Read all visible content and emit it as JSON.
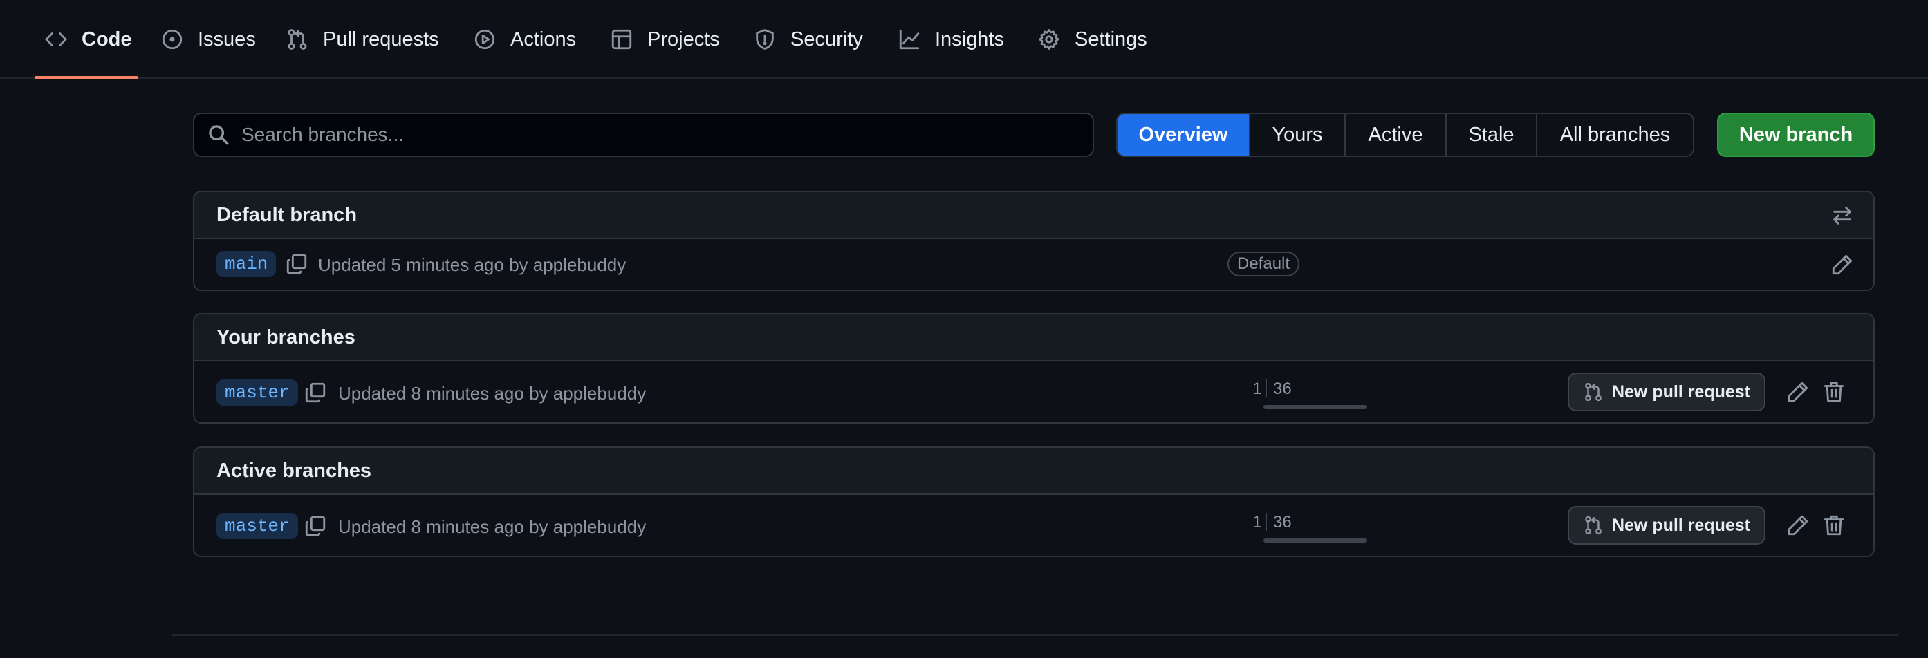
{
  "nav": {
    "tabs": [
      {
        "label": "Code",
        "icon": "code-icon",
        "selected": true
      },
      {
        "label": "Issues",
        "icon": "issue-opened-icon"
      },
      {
        "label": "Pull requests",
        "icon": "git-pull-request-icon"
      },
      {
        "label": "Actions",
        "icon": "play-icon"
      },
      {
        "label": "Projects",
        "icon": "table-icon"
      },
      {
        "label": "Security",
        "icon": "shield-icon"
      },
      {
        "label": "Insights",
        "icon": "graph-icon"
      },
      {
        "label": "Settings",
        "icon": "gear-icon"
      }
    ]
  },
  "toolbar": {
    "search_placeholder": "Search branches...",
    "filters": [
      {
        "label": "Overview",
        "active": true
      },
      {
        "label": "Yours"
      },
      {
        "label": "Active"
      },
      {
        "label": "Stale"
      },
      {
        "label": "All branches"
      }
    ],
    "new_branch_label": "New branch"
  },
  "sections": {
    "default": {
      "title": "Default branch",
      "row": {
        "branch": "main",
        "updated": "Updated 5 minutes ago by applebuddy",
        "badge": "Default"
      }
    },
    "yours": {
      "title": "Your branches",
      "row": {
        "branch": "master",
        "updated": "Updated 8 minutes ago by applebuddy",
        "behind": "1",
        "ahead": "36",
        "pr_label": "New pull request"
      }
    },
    "active": {
      "title": "Active branches",
      "row": {
        "branch": "master",
        "updated": "Updated 8 minutes ago by applebuddy",
        "behind": "1",
        "ahead": "36",
        "pr_label": "New pull request"
      }
    }
  },
  "colors": {
    "background": "#0d1117",
    "accent_selected": "#1f6feb",
    "primary_button": "#238636",
    "tab_underline": "#f78166",
    "branch_chip_text": "#6cb6ff"
  }
}
